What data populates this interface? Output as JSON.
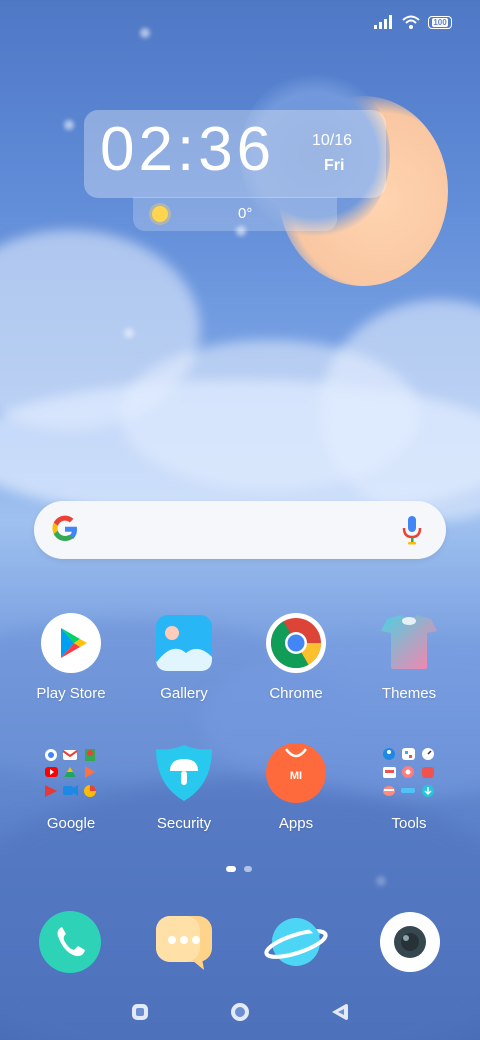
{
  "status_bar": {
    "battery": "100",
    "icons": [
      "signal-icon",
      "wifi-icon",
      "battery-icon"
    ]
  },
  "clock_widget": {
    "time": "02:36",
    "date": "10/16",
    "day": "Fri",
    "weather_icon": "sun-icon",
    "temperature": "0°"
  },
  "search_bar": {
    "logo": "google-g-icon",
    "mic": "microphone-icon"
  },
  "apps_row1": [
    {
      "label": "Play Store",
      "icon": "play-store-icon"
    },
    {
      "label": "Gallery",
      "icon": "gallery-icon"
    },
    {
      "label": "Chrome",
      "icon": "chrome-icon"
    },
    {
      "label": "Themes",
      "icon": "themes-icon"
    }
  ],
  "apps_row2": [
    {
      "label": "Google",
      "icon": "google-folder-icon"
    },
    {
      "label": "Security",
      "icon": "security-icon"
    },
    {
      "label": "Apps",
      "icon": "mi-apps-icon"
    },
    {
      "label": "Tools",
      "icon": "tools-folder-icon"
    }
  ],
  "page_indicator": {
    "pages": 2,
    "active": 1
  },
  "dock": [
    {
      "icon": "phone-icon"
    },
    {
      "icon": "messages-icon"
    },
    {
      "icon": "browser-icon"
    },
    {
      "icon": "camera-icon"
    }
  ],
  "nav_bar": {
    "buttons": [
      "recents-button",
      "home-button",
      "back-button"
    ]
  },
  "colors": {
    "sky": "#5f8bd7",
    "moon": "#f9c7a2",
    "phone": "#2ed3b7",
    "security": "#29c8ee",
    "apps": "#ff6a3d"
  }
}
